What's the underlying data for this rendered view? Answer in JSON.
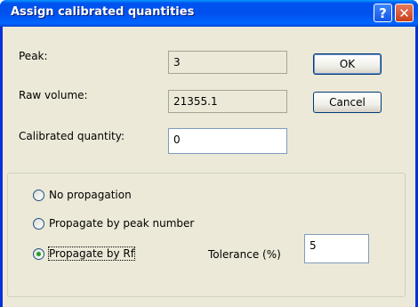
{
  "window": {
    "title": "Assign calibrated quantities",
    "help_glyph": "?",
    "close_glyph": "✕"
  },
  "fields": {
    "peak_label": "Peak:",
    "peak_value": "3",
    "raw_volume_label": "Raw volume:",
    "raw_volume_value": "21355.1",
    "calibrated_label": "Calibrated quantity:",
    "calibrated_value": "0"
  },
  "buttons": {
    "ok": "OK",
    "cancel": "Cancel"
  },
  "propagation": {
    "options": [
      {
        "label": "No propagation",
        "checked": false
      },
      {
        "label": "Propagate by peak number",
        "checked": false
      },
      {
        "label": "Propagate by Rf",
        "checked": true
      }
    ],
    "tolerance_label": "Tolerance (%)",
    "tolerance_value": "5"
  }
}
